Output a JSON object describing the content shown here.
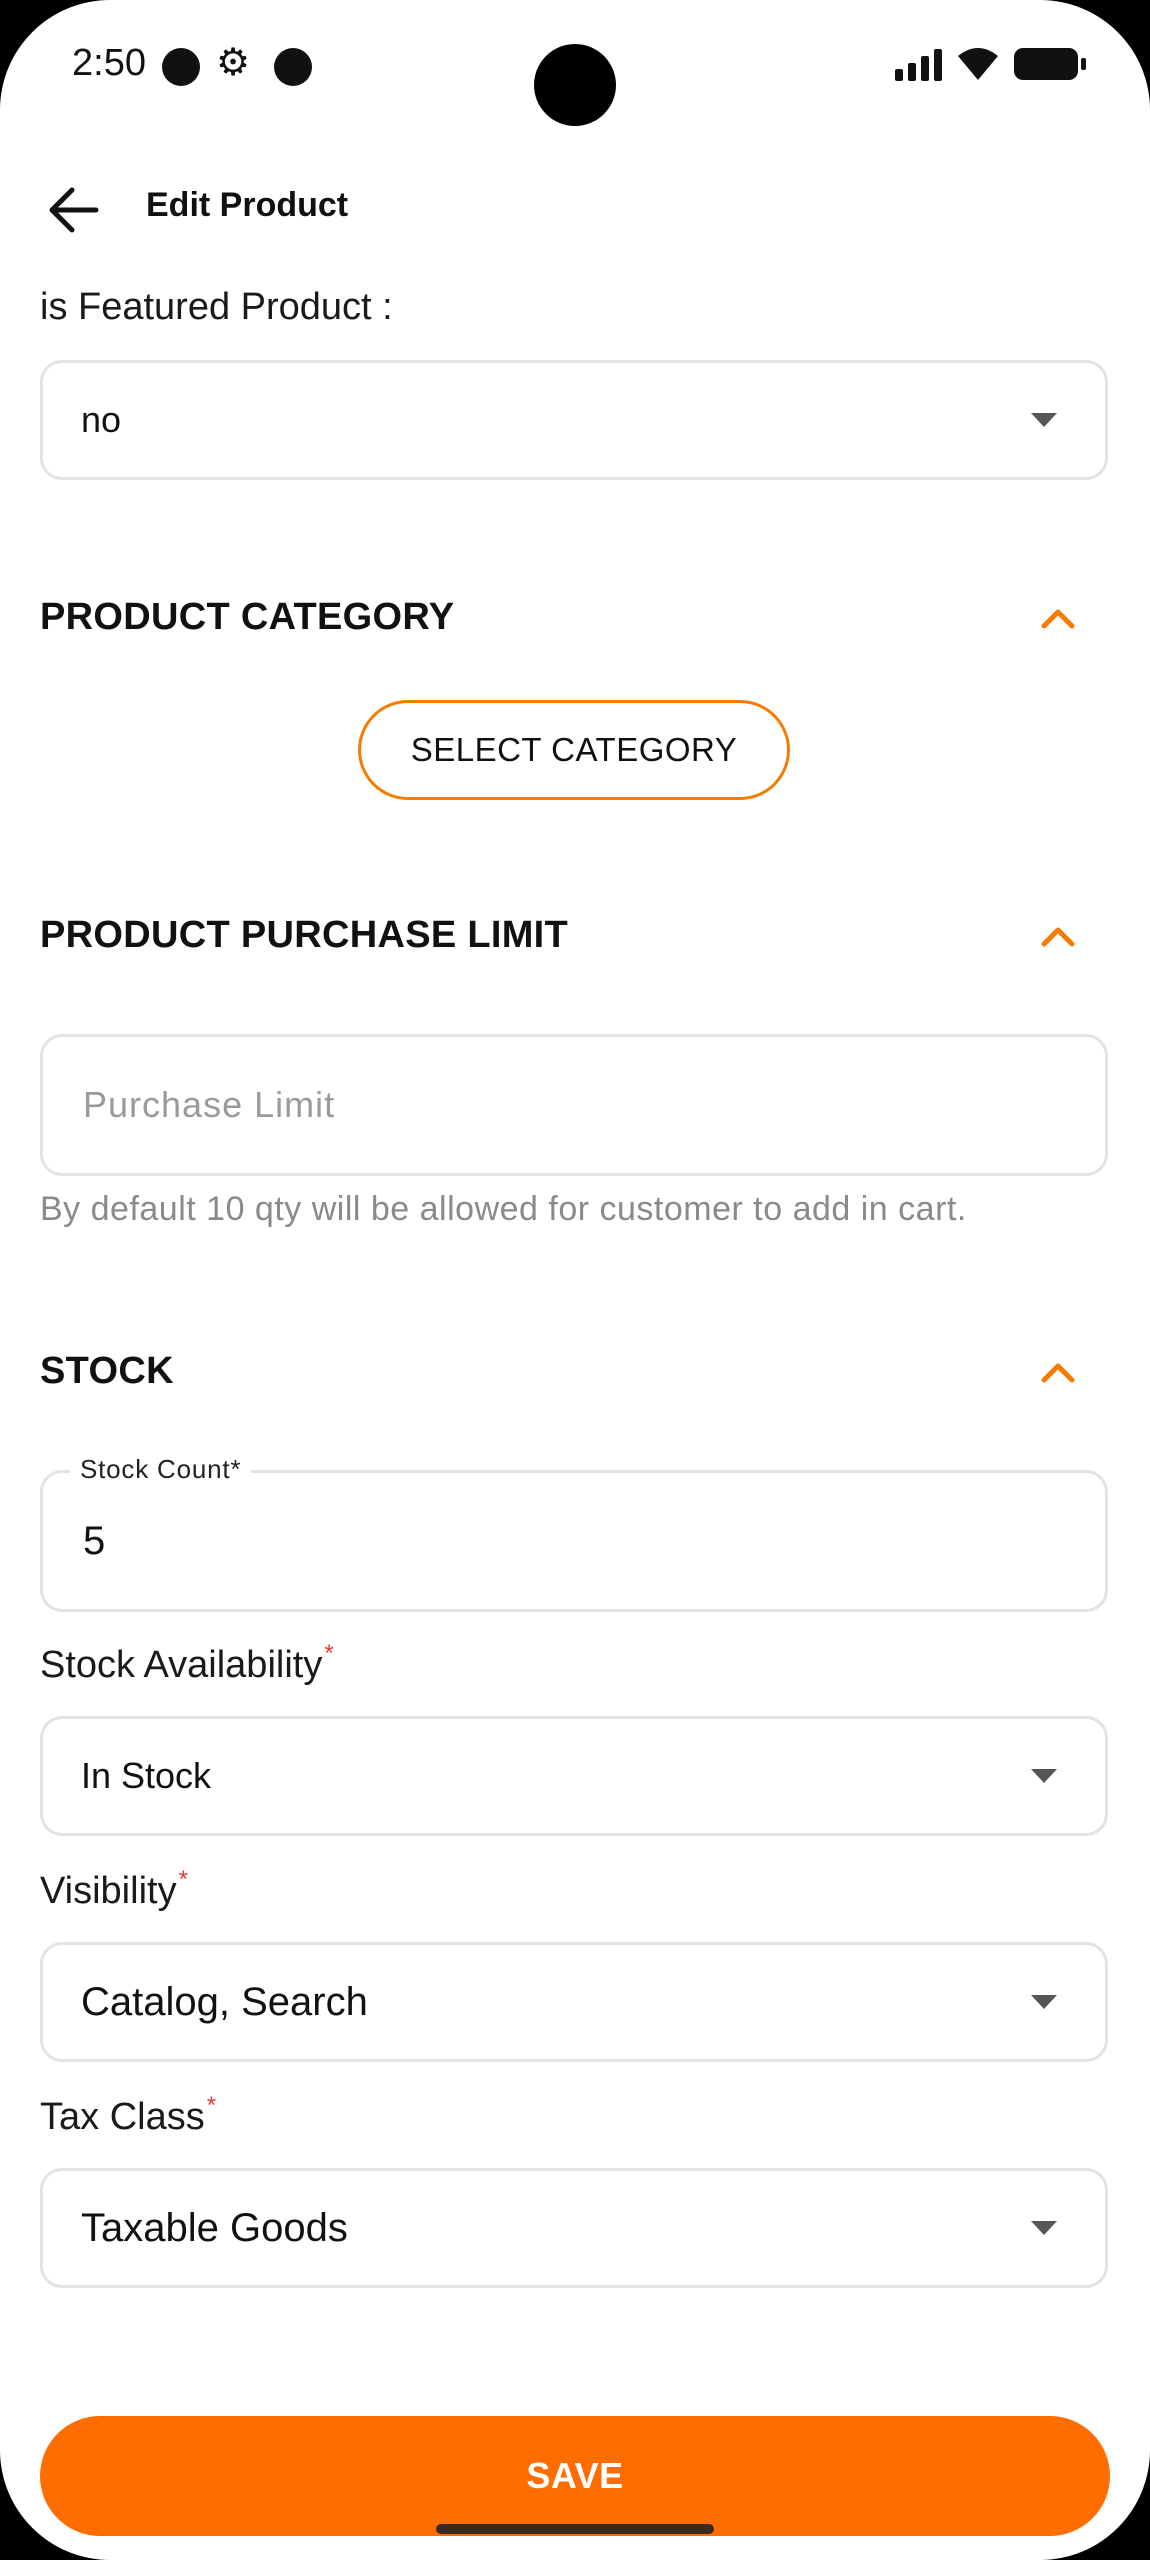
{
  "status_bar": {
    "time": "2:50"
  },
  "header": {
    "title": "Edit Product"
  },
  "featured": {
    "label": "is Featured Product :",
    "value": "no"
  },
  "category_section": {
    "title": "PRODUCT CATEGORY",
    "button_label": "SELECT CATEGORY"
  },
  "purchase_limit_section": {
    "title": "PRODUCT PURCHASE LIMIT",
    "placeholder": "Purchase Limit",
    "helper": "By default 10 qty will be allowed for customer to add in cart."
  },
  "stock_section": {
    "title": "STOCK",
    "stock_count_label": "Stock Count*",
    "stock_count_value": "5",
    "availability_label": "Stock Availability",
    "availability_value": "In Stock",
    "visibility_label": "Visibility",
    "visibility_value": "Catalog, Search",
    "tax_label": "Tax Class",
    "tax_value": "Taxable Goods",
    "required_mark": "*"
  },
  "footer": {
    "save_label": "SAVE"
  },
  "colors": {
    "accent": "#ff6d00",
    "required": "#e53935"
  }
}
